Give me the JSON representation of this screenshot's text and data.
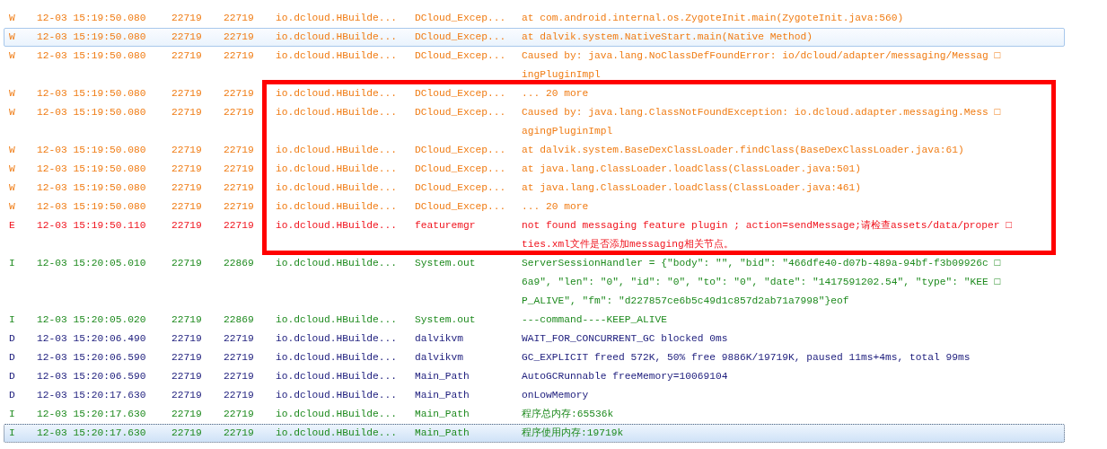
{
  "log_rows": [
    {
      "level": "W",
      "time": "12-03 15:19:50.080",
      "pid": "22719",
      "tid": "22719",
      "application": "io.dcloud.HBuilde...",
      "tag": "DCloud_Excep...",
      "message": [
        "at com.android.internal.os.ZygoteInit.main(ZygoteInit.java:560)"
      ],
      "hovered": false,
      "selected": false
    },
    {
      "level": "W",
      "time": "12-03 15:19:50.080",
      "pid": "22719",
      "tid": "22719",
      "application": "io.dcloud.HBuilde...",
      "tag": "DCloud_Excep...",
      "message": [
        "at dalvik.system.NativeStart.main(Native Method)"
      ],
      "hovered": true,
      "selected": false
    },
    {
      "level": "W",
      "time": "12-03 15:19:50.080",
      "pid": "22719",
      "tid": "22719",
      "application": "io.dcloud.HBuilde...",
      "tag": "DCloud_Excep...",
      "message": [
        "Caused by: java.lang.NoClassDefFoundError: io/dcloud/adapter/messaging/Messag □",
        "ingPluginImpl"
      ],
      "hovered": false,
      "selected": false
    },
    {
      "level": "W",
      "time": "12-03 15:19:50.080",
      "pid": "22719",
      "tid": "22719",
      "application": "io.dcloud.HBuilde...",
      "tag": "DCloud_Excep...",
      "message": [
        "... 20 more"
      ],
      "hovered": false,
      "selected": false
    },
    {
      "level": "W",
      "time": "12-03 15:19:50.080",
      "pid": "22719",
      "tid": "22719",
      "application": "io.dcloud.HBuilde...",
      "tag": "DCloud_Excep...",
      "message": [
        "Caused by: java.lang.ClassNotFoundException: io.dcloud.adapter.messaging.Mess □",
        "agingPluginImpl"
      ],
      "hovered": false,
      "selected": false
    },
    {
      "level": "W",
      "time": "12-03 15:19:50.080",
      "pid": "22719",
      "tid": "22719",
      "application": "io.dcloud.HBuilde...",
      "tag": "DCloud_Excep...",
      "message": [
        "at dalvik.system.BaseDexClassLoader.findClass(BaseDexClassLoader.java:61)"
      ],
      "hovered": false,
      "selected": false
    },
    {
      "level": "W",
      "time": "12-03 15:19:50.080",
      "pid": "22719",
      "tid": "22719",
      "application": "io.dcloud.HBuilde...",
      "tag": "DCloud_Excep...",
      "message": [
        "at java.lang.ClassLoader.loadClass(ClassLoader.java:501)"
      ],
      "hovered": false,
      "selected": false
    },
    {
      "level": "W",
      "time": "12-03 15:19:50.080",
      "pid": "22719",
      "tid": "22719",
      "application": "io.dcloud.HBuilde...",
      "tag": "DCloud_Excep...",
      "message": [
        "at java.lang.ClassLoader.loadClass(ClassLoader.java:461)"
      ],
      "hovered": false,
      "selected": false
    },
    {
      "level": "W",
      "time": "12-03 15:19:50.080",
      "pid": "22719",
      "tid": "22719",
      "application": "io.dcloud.HBuilde...",
      "tag": "DCloud_Excep...",
      "message": [
        "... 20 more"
      ],
      "hovered": false,
      "selected": false
    },
    {
      "level": "E",
      "time": "12-03 15:19:50.110",
      "pid": "22719",
      "tid": "22719",
      "application": "io.dcloud.HBuilde...",
      "tag": "featuremgr",
      "message": [
        "not found messaging feature plugin ; action=sendMessage;请检查assets/data/proper □",
        "ties.xml文件是否添加messaging相关节点。"
      ],
      "hovered": false,
      "selected": false
    },
    {
      "level": "I",
      "time": "12-03 15:20:05.010",
      "pid": "22719",
      "tid": "22869",
      "application": "io.dcloud.HBuilde...",
      "tag": "System.out",
      "message": [
        "ServerSessionHandler = {\"body\": \"\", \"bid\": \"466dfe40-d07b-489a-94bf-f3b09926c □",
        "6a9\", \"len\": \"0\", \"id\": \"0\", \"to\": \"0\", \"date\": \"1417591202.54\", \"type\": \"KEE □",
        "P_ALIVE\", \"fm\": \"d227857ce6b5c49d1c857d2ab71a7998\"}eof"
      ],
      "hovered": false,
      "selected": false
    },
    {
      "level": "I",
      "time": "12-03 15:20:05.020",
      "pid": "22719",
      "tid": "22869",
      "application": "io.dcloud.HBuilde...",
      "tag": "System.out",
      "message": [
        "---command----KEEP_ALIVE"
      ],
      "hovered": false,
      "selected": false
    },
    {
      "level": "D",
      "time": "12-03 15:20:06.490",
      "pid": "22719",
      "tid": "22719",
      "application": "io.dcloud.HBuilde...",
      "tag": "dalvikvm",
      "message": [
        "WAIT_FOR_CONCURRENT_GC blocked 0ms"
      ],
      "hovered": false,
      "selected": false
    },
    {
      "level": "D",
      "time": "12-03 15:20:06.590",
      "pid": "22719",
      "tid": "22719",
      "application": "io.dcloud.HBuilde...",
      "tag": "dalvikvm",
      "message": [
        "GC_EXPLICIT freed 572K, 50% free 9886K/19719K, paused 11ms+4ms, total 99ms"
      ],
      "hovered": false,
      "selected": false
    },
    {
      "level": "D",
      "time": "12-03 15:20:06.590",
      "pid": "22719",
      "tid": "22719",
      "application": "io.dcloud.HBuilde...",
      "tag": "Main_Path",
      "message": [
        "AutoGCRunnable freeMemory=10069104"
      ],
      "hovered": false,
      "selected": false
    },
    {
      "level": "D",
      "time": "12-03 15:20:17.630",
      "pid": "22719",
      "tid": "22719",
      "application": "io.dcloud.HBuilde...",
      "tag": "Main_Path",
      "message": [
        "onLowMemory"
      ],
      "hovered": false,
      "selected": false
    },
    {
      "level": "I",
      "time": "12-03 15:20:17.630",
      "pid": "22719",
      "tid": "22719",
      "application": "io.dcloud.HBuilde...",
      "tag": "Main_Path",
      "message": [
        "程序总内存:65536k"
      ],
      "hovered": false,
      "selected": false
    },
    {
      "level": "I",
      "time": "12-03 15:20:17.630",
      "pid": "22719",
      "tid": "22719",
      "application": "io.dcloud.HBuilde...",
      "tag": "Main_Path",
      "message": [
        "程序使用内存:19719k"
      ],
      "hovered": false,
      "selected": true
    }
  ],
  "annotation": {
    "kind": "highlight-frame"
  }
}
